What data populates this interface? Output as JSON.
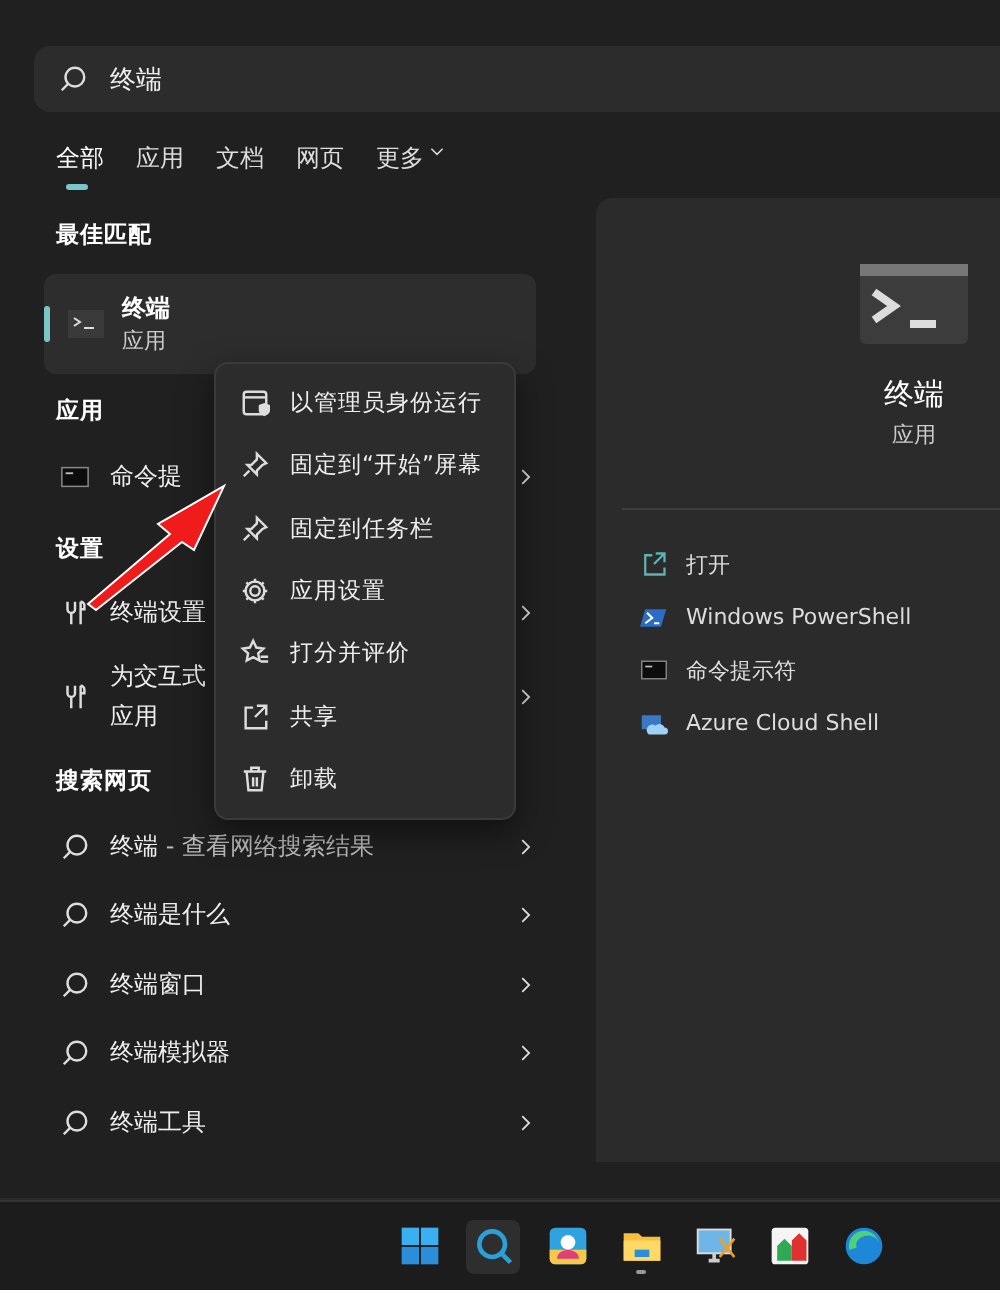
{
  "search": {
    "value": "终端"
  },
  "tabs": [
    {
      "label": "全部",
      "selected": true,
      "has_menu": false
    },
    {
      "label": "应用",
      "selected": false,
      "has_menu": false
    },
    {
      "label": "文档",
      "selected": false,
      "has_menu": false
    },
    {
      "label": "网页",
      "selected": false,
      "has_menu": false
    },
    {
      "label": "更多",
      "selected": false,
      "has_menu": true
    }
  ],
  "best_match": {
    "heading": "最佳匹配",
    "title": "终端",
    "subtitle": "应用",
    "selected": true
  },
  "sections": [
    {
      "heading": "应用",
      "items": [
        {
          "kind": "cmd",
          "title": "命令提"
        }
      ]
    },
    {
      "heading": "设置",
      "items": [
        {
          "kind": "settings",
          "title": "终端设置"
        },
        {
          "kind": "settings",
          "title": "为交互式",
          "subtitle": "应用"
        }
      ]
    },
    {
      "heading": "搜索网页",
      "items": [
        {
          "kind": "web",
          "title": "终端",
          "note": "- 查看网络搜索结果"
        },
        {
          "kind": "web",
          "title": "终端是什么"
        },
        {
          "kind": "web",
          "title": "终端窗口"
        },
        {
          "kind": "web",
          "title": "终端模拟器"
        },
        {
          "kind": "web",
          "title": "终端工具"
        }
      ]
    }
  ],
  "context_menu": {
    "items": [
      {
        "kind": "admin",
        "label": "以管理员身份运行"
      },
      {
        "kind": "pin",
        "label": "固定到“开始”屏幕"
      },
      {
        "kind": "pin",
        "label": "固定到任务栏"
      },
      {
        "kind": "gear",
        "label": "应用设置"
      },
      {
        "kind": "rate",
        "label": "打分并评价"
      },
      {
        "kind": "share",
        "label": "共享"
      },
      {
        "kind": "trash",
        "label": "卸载"
      }
    ]
  },
  "detail": {
    "title": "终端",
    "subtitle": "应用",
    "actions": [
      {
        "kind": "open",
        "label": "打开"
      },
      {
        "kind": "powershell",
        "label": "Windows PowerShell"
      },
      {
        "kind": "cmd",
        "label": "命令提示符"
      },
      {
        "kind": "cloud",
        "label": "Azure Cloud Shell"
      }
    ]
  },
  "taskbar": [
    {
      "kind": "start",
      "selected": false,
      "running": false
    },
    {
      "kind": "search",
      "selected": true,
      "running": false
    },
    {
      "kind": "photos",
      "selected": false,
      "running": false
    },
    {
      "kind": "folder",
      "selected": false,
      "running": true
    },
    {
      "kind": "snip",
      "selected": false,
      "running": false
    },
    {
      "kind": "chart",
      "selected": false,
      "running": false
    },
    {
      "kind": "browser",
      "selected": false,
      "running": false
    }
  ]
}
